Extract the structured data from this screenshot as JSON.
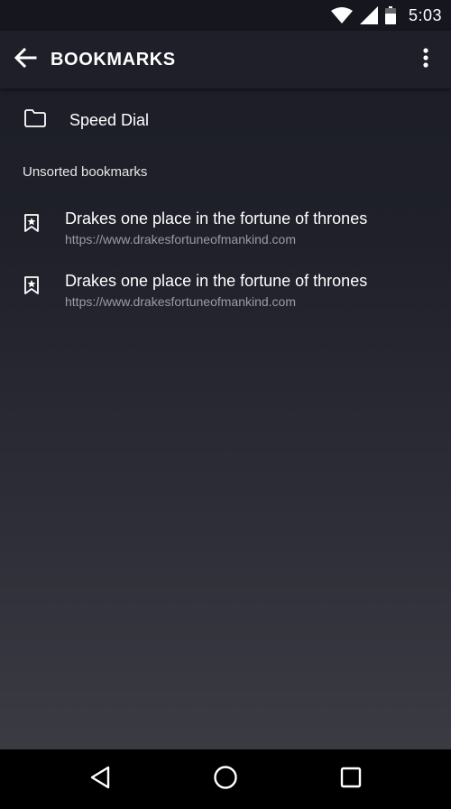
{
  "status_bar": {
    "time": "5:03",
    "icons": [
      "wifi-icon",
      "cell-signal-icon",
      "battery-icon"
    ]
  },
  "app_bar": {
    "title": "BOOKMARKS",
    "back_icon": "arrow-back-icon",
    "menu_icon": "more-vert-icon"
  },
  "speed_dial": {
    "label": "Speed Dial",
    "icon": "folder-icon"
  },
  "section": {
    "header": "Unsorted bookmarks"
  },
  "bookmarks": [
    {
      "title": "Drakes one place in the fortune of thrones",
      "url": "https://www.drakesfortuneofmankind.com",
      "icon": "bookmark-icon"
    },
    {
      "title": "Drakes one place in the fortune of thrones",
      "url": "https://www.drakesfortuneofmankind.com",
      "icon": "bookmark-icon"
    }
  ],
  "nav_bar": {
    "icons": [
      "nav-back-icon",
      "nav-home-icon",
      "nav-recents-icon"
    ]
  },
  "colors": {
    "background": "#1f2029",
    "app_bar": "#1e1f29",
    "text_primary": "#ffffff",
    "text_secondary": "#9a9ba3"
  }
}
